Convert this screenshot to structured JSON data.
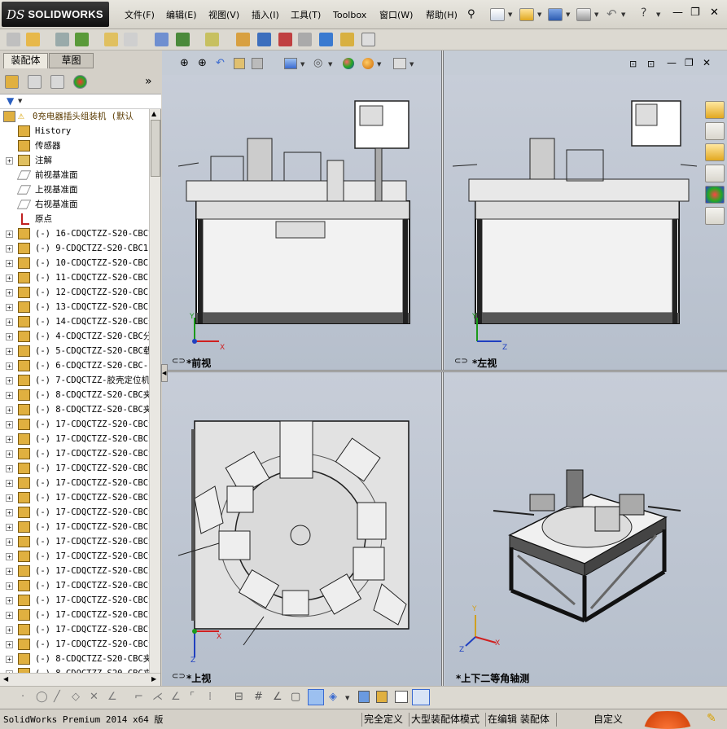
{
  "app": {
    "logo_ds": "DS",
    "logo_text": "SOLIDWORKS"
  },
  "menu": [
    "文件(F)",
    "编辑(E)",
    "视图(V)",
    "插入(I)",
    "工具(T)",
    "Toolbox",
    "窗口(W)",
    "帮助(H)"
  ],
  "window_controls": {
    "minimize": "—",
    "restore": "❐",
    "close": "✕"
  },
  "panel_tabs": [
    "装配体",
    "草图"
  ],
  "fm_expand": "»",
  "tree": {
    "root": "0充电器插头组装机  (默认",
    "items": [
      {
        "label": "History",
        "icon": "history-icon",
        "exp": ""
      },
      {
        "label": "传感器",
        "icon": "sensor-icon",
        "exp": ""
      },
      {
        "label": "注解",
        "icon": "annotation-icon",
        "exp": "+"
      },
      {
        "label": "前视基准面",
        "icon": "plane-icon",
        "exp": ""
      },
      {
        "label": "上视基准面",
        "icon": "plane-icon",
        "exp": ""
      },
      {
        "label": "右视基准面",
        "icon": "plane-icon",
        "exp": ""
      },
      {
        "label": "原点",
        "icon": "origin-icon",
        "exp": ""
      },
      {
        "label": "(-) 16-CDQCTZZ-S20-CBC前",
        "icon": "subassembly-icon",
        "exp": "+"
      },
      {
        "label": "(-) 9-CDQCTZZ-S20-CBC11",
        "icon": "subassembly-icon",
        "exp": "+"
      },
      {
        "label": "(-) 10-CDQCTZZ-S20-CBC1",
        "icon": "subassembly-icon",
        "exp": "+"
      },
      {
        "label": "(-) 11-CDQCTZZ-S20-CBC1",
        "icon": "subassembly-icon",
        "exp": "+"
      },
      {
        "label": "(-) 12-CDQCTZZ-S20-CBC1",
        "icon": "subassembly-icon",
        "exp": "+"
      },
      {
        "label": "(-) 13-CDQCTZZ-S20-CBC分",
        "icon": "subassembly-icon",
        "exp": "+"
      },
      {
        "label": "(-) 14-CDQCTZZ-S20-CBC分",
        "icon": "subassembly-icon",
        "exp": "+"
      },
      {
        "label": "(-) 4-CDQCTZZ-S20-CBC分",
        "icon": "subassembly-icon",
        "exp": "+"
      },
      {
        "label": "(-) 5-CDQCTZZ-S20-CBC载",
        "icon": "subassembly-icon",
        "exp": "+"
      },
      {
        "label": "(-) 6-CDQCTZZ-S20-CBC-P",
        "icon": "subassembly-icon",
        "exp": "+"
      },
      {
        "label": "(-) 7-CDQCTZZ-胶壳定位机",
        "icon": "subassembly-icon",
        "exp": "+"
      },
      {
        "label": "(-) 8-CDQCTZZ-S20-CBC夹",
        "icon": "subassembly-icon",
        "exp": "+"
      },
      {
        "label": "(-) 8-CDQCTZZ-S20-CBC夹",
        "icon": "subassembly-icon",
        "exp": "+"
      },
      {
        "label": "(-) 17-CDQCTZZ-S20-CBC治",
        "icon": "subassembly-icon",
        "exp": "+"
      },
      {
        "label": "(-) 17-CDQCTZZ-S20-CBC治",
        "icon": "subassembly-icon",
        "exp": "+"
      },
      {
        "label": "(-) 17-CDQCTZZ-S20-CBC治",
        "icon": "subassembly-icon",
        "exp": "+"
      },
      {
        "label": "(-) 17-CDQCTZZ-S20-CBC治",
        "icon": "subassembly-icon",
        "exp": "+"
      },
      {
        "label": "(-) 17-CDQCTZZ-S20-CBC治",
        "icon": "subassembly-icon",
        "exp": "+"
      },
      {
        "label": "(-) 17-CDQCTZZ-S20-CBC治",
        "icon": "subassembly-icon",
        "exp": "+"
      },
      {
        "label": "(-) 17-CDQCTZZ-S20-CBC治",
        "icon": "subassembly-icon",
        "exp": "+"
      },
      {
        "label": "(-) 17-CDQCTZZ-S20-CBC治",
        "icon": "subassembly-icon",
        "exp": "+"
      },
      {
        "label": "(-) 17-CDQCTZZ-S20-CBC治",
        "icon": "subassembly-icon",
        "exp": "+"
      },
      {
        "label": "(-) 17-CDQCTZZ-S20-CBC治",
        "icon": "subassembly-icon",
        "exp": "+"
      },
      {
        "label": "(-) 17-CDQCTZZ-S20-CBC治",
        "icon": "subassembly-icon",
        "exp": "+"
      },
      {
        "label": "(-) 17-CDQCTZZ-S20-CBC治",
        "icon": "subassembly-icon",
        "exp": "+"
      },
      {
        "label": "(-) 17-CDQCTZZ-S20-CBC治",
        "icon": "subassembly-icon",
        "exp": "+"
      },
      {
        "label": "(-) 17-CDQCTZZ-S20-CBC治",
        "icon": "subassembly-icon",
        "exp": "+"
      },
      {
        "label": "(-) 17-CDQCTZZ-S20-CBC治",
        "icon": "subassembly-icon",
        "exp": "+"
      },
      {
        "label": "(-) 17-CDQCTZZ-S20-CBC治",
        "icon": "subassembly-icon",
        "exp": "+"
      },
      {
        "label": "(-) 8-CDQCTZZ-S20-CBC夹",
        "icon": "subassembly-icon",
        "exp": "+"
      },
      {
        "label": "(-) 8-CDQCTZZ-S20-CBC夹",
        "icon": "subassembly-icon",
        "exp": "+"
      }
    ]
  },
  "viewports": {
    "front": "*前视",
    "left": "*左视",
    "top": "*上视",
    "iso": "*上下二等角轴测"
  },
  "axes": {
    "x": "X",
    "y": "Y",
    "z": "Z"
  },
  "status": {
    "product": "SolidWorks Premium 2014 x64 版",
    "state": "完全定义",
    "mode": "大型装配体模式",
    "editing": "在编辑 装配体",
    "custom": "自定义"
  },
  "colors": {
    "accent": "#ff3b1f",
    "axis_x": "#d02020",
    "axis_y": "#d0a020",
    "axis_z": "#2040c0"
  }
}
